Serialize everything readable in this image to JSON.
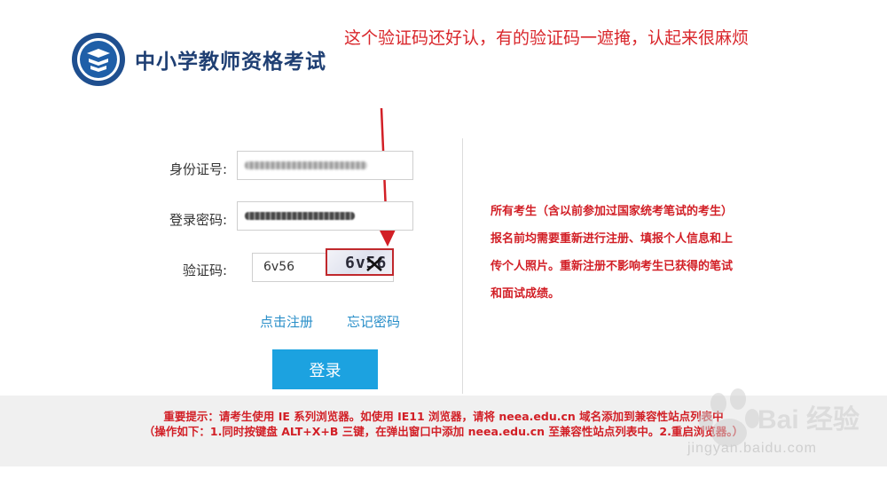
{
  "header": {
    "site_title": "中小学教师资格考试"
  },
  "annotation": {
    "text": "这个验证码还好认，有的验证码一遮掩，认起来很麻烦",
    "color": "#d9262b"
  },
  "login_form": {
    "id_label": "身份证号:",
    "password_label": "登录密码:",
    "captcha_label": "验证码:",
    "captcha_value": "6v56",
    "captcha_image_text": "6v56",
    "register_link": "点击注册",
    "forgot_link": "忘记密码",
    "login_button": "登录",
    "accent_color": "#1ca2e0"
  },
  "notice": {
    "text": "所有考生（含以前参加过国家统考笔试的考生）报名前均需要重新进行注册、填报个人信息和上传个人照片。重新注册不影响考生已获得的笔试和面试成绩。",
    "color": "#d21f26"
  },
  "footer": {
    "tip_line1": "重要提示：请考生使用 IE 系列浏览器。如使用 IE11 浏览器，请将 neea.edu.cn 域名添加到兼容性站点列表中",
    "tip_line2": "（操作如下：1.同时按键盘 ALT+X+B 三键，在弹出窗口中添加 neea.edu.cn 至兼容性站点列表中。2.重启浏览器。）"
  },
  "watermark": {
    "text": "Bai 经验",
    "url": "jingyan.baidu.com"
  }
}
